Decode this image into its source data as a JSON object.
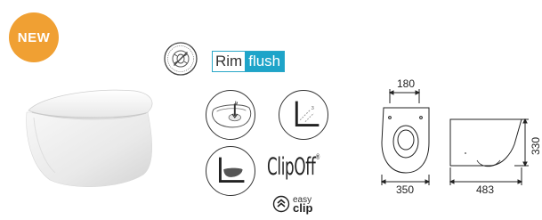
{
  "badge": {
    "label": "NEW",
    "color": "#f0a033"
  },
  "logos": {
    "antibacterial_seal": "antibacterial-seal-icon",
    "rimflush": {
      "part1": "Rim",
      "part2": "flush",
      "accent": "#1ea4c9"
    },
    "clipoff": {
      "text": "ClipOff",
      "mark": "®"
    },
    "easyclip": {
      "line1": "easy",
      "line2": "clip"
    }
  },
  "features": [
    {
      "icon": "rimless-flush-icon"
    },
    {
      "icon": "wall-hung-icon"
    },
    {
      "icon": "soft-close-seat-icon"
    }
  ],
  "dimensions": {
    "top_width": "180",
    "front_width": "350",
    "side_depth": "483",
    "height": "330"
  }
}
